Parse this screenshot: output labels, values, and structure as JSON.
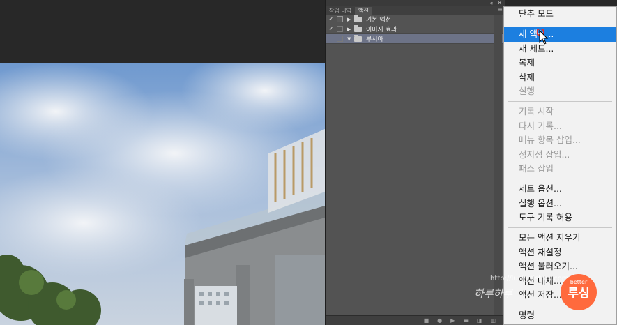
{
  "panel": {
    "topbar_icons": [
      "«",
      "✕"
    ],
    "tabs": [
      {
        "label": "작업 내역",
        "active": false
      },
      {
        "label": "액션",
        "active": true
      }
    ],
    "menu_button": "≡",
    "rows": [
      {
        "label": "기본 액션",
        "checked": true,
        "expanded": false,
        "selected": false
      },
      {
        "label": "이미지 효과",
        "checked": true,
        "expanded": false,
        "selected": false
      },
      {
        "label": "루시아",
        "checked": false,
        "expanded": true,
        "selected": true
      }
    ],
    "bottom_icons": [
      "stop-icon",
      "record-icon",
      "play-icon",
      "new-set-icon",
      "new-action-icon",
      "trash-icon"
    ]
  },
  "menu": {
    "groups": [
      [
        {
          "label": "단추 모드",
          "enabled": true
        }
      ],
      [
        {
          "label": "새 액션...",
          "enabled": true,
          "highlighted": true
        },
        {
          "label": "새 세트...",
          "enabled": true
        },
        {
          "label": "복제",
          "enabled": true
        },
        {
          "label": "삭제",
          "enabled": true
        },
        {
          "label": "실행",
          "enabled": false
        }
      ],
      [
        {
          "label": "기록 시작",
          "enabled": false
        },
        {
          "label": "다시 기록...",
          "enabled": false
        },
        {
          "label": "메뉴 항목 삽입...",
          "enabled": false
        },
        {
          "label": "정지점 삽입...",
          "enabled": false
        },
        {
          "label": "패스 삽입",
          "enabled": false
        }
      ],
      [
        {
          "label": "세트 옵션...",
          "enabled": true
        },
        {
          "label": "실행 옵션...",
          "enabled": true
        },
        {
          "label": "도구 기록 허용",
          "enabled": true
        }
      ],
      [
        {
          "label": "모든 액션 지우기",
          "enabled": true
        },
        {
          "label": "액션 재설정",
          "enabled": true
        },
        {
          "label": "액션 불러오기...",
          "enabled": true
        },
        {
          "label": "액션 대체...",
          "enabled": true
        },
        {
          "label": "액션 저장...",
          "enabled": true
        }
      ],
      [
        {
          "label": "명령",
          "enabled": true
        }
      ]
    ]
  },
  "watermark": {
    "url": "http://lucia.tistory.com",
    "handwriting": "하루하루",
    "badge_top": "better",
    "badge_main": "루싱"
  },
  "colors": {
    "menu_highlight": "#1c7fe0",
    "panel_bg": "#535353",
    "selected_row": "#6d7387",
    "badge": "#ff6a3d"
  }
}
